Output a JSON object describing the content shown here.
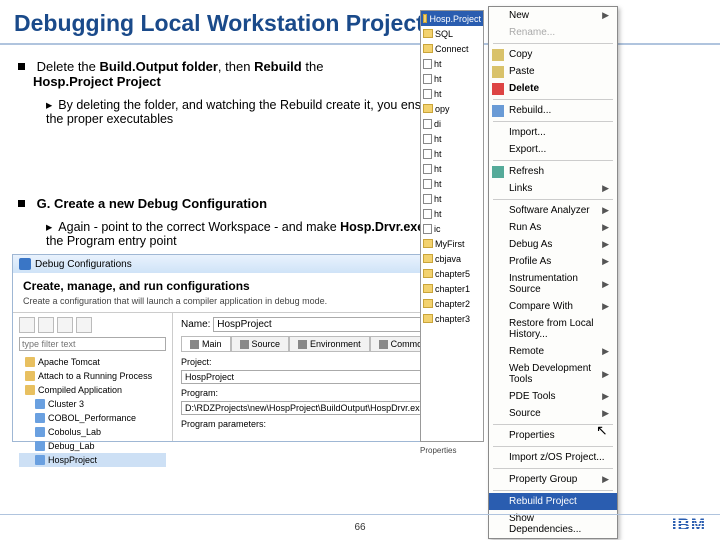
{
  "title": "Debugging Local Workstation Projects",
  "bullet1": {
    "pre": "Delete the ",
    "bold1": "Build.Output folder",
    "mid": ", then ",
    "bold2": "Rebuild",
    "post": " the ",
    "line2": "Hosp.Project Project"
  },
  "sub1": "By deleting the folder, and watching the Rebuild create it, you ensure the proper executables",
  "bullet2": "G. Create a new Debug Configuration",
  "sub2_pre": "Again - point to the correct Workspace - and make ",
  "sub2_bold": "Hosp.Drvr.exe",
  "sub2_post": " the Program entry point",
  "debug": {
    "window_title": "Debug Configurations",
    "header_title": "Create, manage, and run configurations",
    "header_sub": "Create a configuration that will launch a compiler application in debug mode.",
    "filter_placeholder": "type filter text",
    "tree": [
      "Apache Tomcat",
      "Attach to a Running Process",
      "Compiled Application",
      "Cluster 3",
      "COBOL_Performance",
      "Cobolus_Lab",
      "Debug_Lab",
      "HospProject"
    ],
    "name_label": "Name:",
    "name_value": "HospProject",
    "tabs": [
      "Main",
      "Source",
      "Environment",
      "Common"
    ],
    "project_label": "Project:",
    "project_value": "HospProject",
    "program_label": "Program:",
    "program_value": "D:\\RDZProjects\\new\\HospProject\\BuildOutput\\HospDrvr.exe",
    "params_label": "Program parameters:"
  },
  "tree_strip_top": "Hosp.Project",
  "tree_strip_items": [
    "SQL",
    "Connect",
    "ht",
    "ht",
    "ht",
    "opy",
    "di",
    "ht",
    "ht",
    "ht",
    "ht",
    "ht",
    "ht",
    "ic",
    "MyFirst",
    "cbjava",
    "chapter5",
    "chapter1",
    "chapter2",
    "chapter3"
  ],
  "properties_label": "Properties",
  "menu": {
    "items": [
      {
        "label": "New",
        "arrow": true
      },
      {
        "label": "Rename...",
        "disabled": true
      },
      {
        "sep": true
      },
      {
        "label": "Copy",
        "icon": "copy"
      },
      {
        "label": "Paste",
        "icon": "paste"
      },
      {
        "label": "Delete",
        "icon": "delete",
        "bold": true
      },
      {
        "sep": true
      },
      {
        "label": "Rebuild...",
        "icon": "rebuild"
      },
      {
        "sep": true
      },
      {
        "label": "Import..."
      },
      {
        "label": "Export..."
      },
      {
        "sep": true
      },
      {
        "label": "Refresh",
        "icon": "refresh"
      },
      {
        "label": "Links",
        "arrow": true
      },
      {
        "sep": true
      },
      {
        "label": "Software Analyzer",
        "arrow": true
      },
      {
        "label": "Run As",
        "arrow": true
      },
      {
        "label": "Debug As",
        "arrow": true
      },
      {
        "label": "Profile As",
        "arrow": true
      },
      {
        "label": "Instrumentation Source",
        "arrow": true
      },
      {
        "label": "Compare With",
        "arrow": true
      },
      {
        "label": "Restore from Local History..."
      },
      {
        "label": "Remote",
        "arrow": true
      },
      {
        "label": "Web Development Tools",
        "arrow": true
      },
      {
        "label": "PDE Tools",
        "arrow": true
      },
      {
        "label": "Source",
        "arrow": true
      },
      {
        "sep": true
      },
      {
        "label": "Properties"
      },
      {
        "sep": true
      },
      {
        "label": "Import z/OS Project..."
      },
      {
        "sep": true
      },
      {
        "label": "Property Group",
        "arrow": true
      },
      {
        "sep": true
      },
      {
        "label": "Rebuild Project",
        "sel": true
      },
      {
        "label": "Show Dependencies..."
      }
    ]
  },
  "page_num": "66",
  "ibm": "IBM"
}
